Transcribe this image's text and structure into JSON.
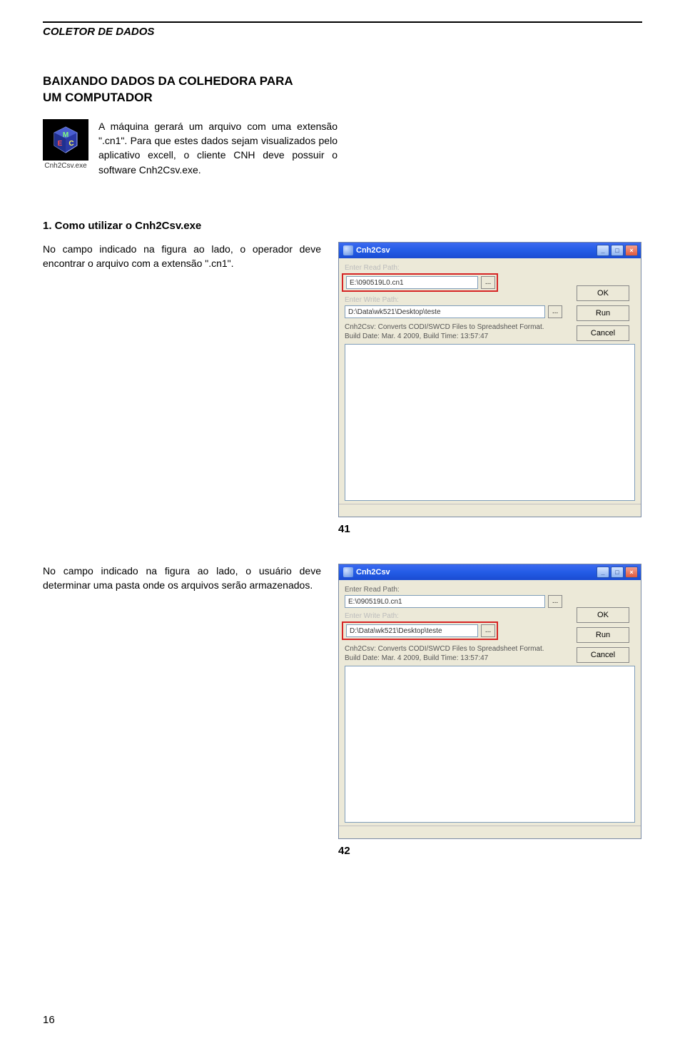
{
  "header": {
    "running_title": "COLETOR DE DADOS"
  },
  "main": {
    "title_line1": "BAIXANDO DADOS DA COLHEDORA PARA",
    "title_line2": "UM COMPUTADOR",
    "icon_caption": "Cnh2Csv.exe",
    "intro_text": "A máquina gerará um arquivo com uma extensão \".cn1\". Para que estes dados sejam visualizados pelo aplicativo excell, o cliente CNH deve possuir o software Cnh2Csv.exe."
  },
  "section1": {
    "heading": "1. Como utilizar o Cnh2Csv.exe",
    "body": "No campo indicado na figura ao lado, o operador deve encontrar o arquivo com a extensão \".cn1\".",
    "fig_num": "41"
  },
  "section2": {
    "body": "No campo indicado na figura ao lado, o usuário deve determinar uma pasta onde os arquivos serão armazenados.",
    "fig_num": "42"
  },
  "window": {
    "title": "Cnh2Csv",
    "read_label": "Enter Read Path:",
    "read_label_faded": "Enter Read Path:",
    "write_label": "Enter Write Path:",
    "write_label_faded": "Enter Write Path:",
    "read_value": "E:\\090519L0.cn1",
    "write_value": "D:\\Data\\wk521\\Desktop\\teste",
    "browse": "...",
    "run": "Run",
    "ok": "OK",
    "cancel": "Cancel",
    "info_line1": "Cnh2Csv: Converts CODI/SWCD Files to Spreadsheet Format.",
    "info_line2": "Build Date: Mar. 4 2009, Build Time: 13:57:47"
  },
  "page_number": "16"
}
